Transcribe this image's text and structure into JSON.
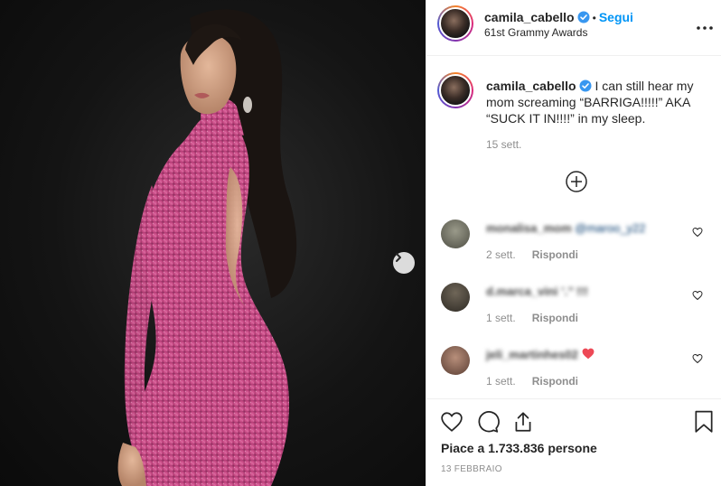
{
  "post": {
    "username": "camila_cabello",
    "follow_label": "Segui",
    "separator": "•",
    "location": "61st Grammy Awards",
    "more_label": "•••",
    "caption": "I can still hear my mom screaming “BARRIGA!!!!!” AKA “SUCK IT IN!!!!” in my sleep.",
    "caption_time": "15 sett.",
    "likes": "Piace a 1.733.836 persone",
    "date": "13 FEBBRAIO"
  },
  "comments": [
    {
      "username": "monalisa_mom",
      "text": "@maroo_y22",
      "time": "2 sett.",
      "reply_label": "Rispondi",
      "avatar_color": "#7a7a6e"
    },
    {
      "username": "d.marca_vini",
      "text": "’.’’ !!!",
      "time": "1 sett.",
      "reply_label": "Rispondi",
      "avatar_color": "#5a5448"
    },
    {
      "username": "jeli_martinhes02",
      "text": "❤️",
      "time": "1 sett.",
      "reply_label": "Rispondi",
      "avatar_color": "#8c6a5a"
    }
  ],
  "icons": {
    "verified": "verified-badge-icon",
    "like": "heart-icon",
    "comment": "comment-icon",
    "share": "share-icon",
    "save": "bookmark-icon",
    "load_more": "plus-circle-icon",
    "next": "chevron-right-icon"
  },
  "colors": {
    "accent": "#0095f6",
    "verified": "#3897f0",
    "dress": "#c84a86",
    "heart": "#ed4956"
  }
}
